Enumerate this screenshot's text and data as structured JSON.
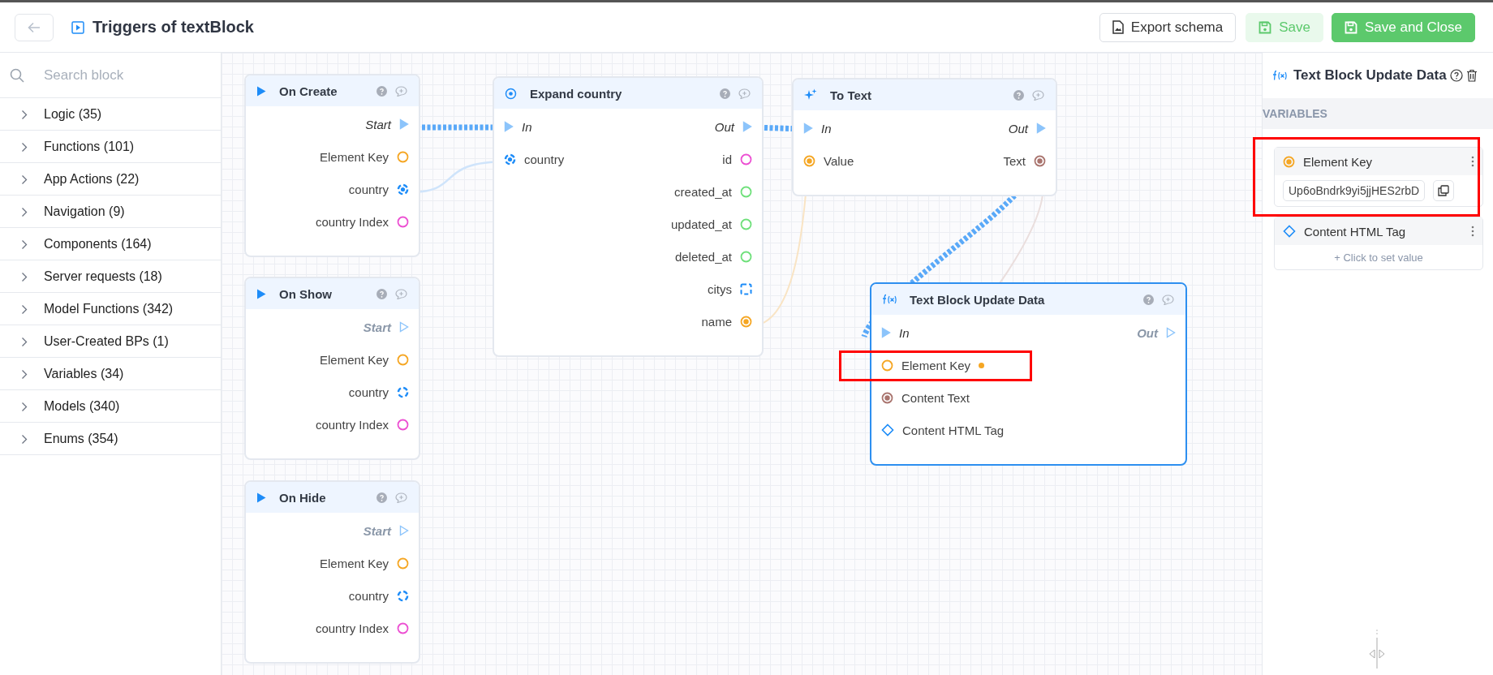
{
  "header": {
    "title": "Triggers of textBlock",
    "buttons": [
      {
        "label": "Export schema",
        "kind": "outline"
      },
      {
        "label": "Save",
        "kind": "light"
      },
      {
        "label": "Save and Close",
        "kind": "primary"
      }
    ]
  },
  "sidebar": {
    "search": {
      "placeholder": "Search block"
    },
    "items": [
      {
        "label": "Logic (35)"
      },
      {
        "label": "Functions (101)"
      },
      {
        "label": "App Actions (22)"
      },
      {
        "label": "Navigation (9)"
      },
      {
        "label": "Components (164)"
      },
      {
        "label": "Server requests (18)"
      },
      {
        "label": "Model Functions (342)"
      },
      {
        "label": "User-Created BPs (1)"
      },
      {
        "label": "Variables (34)"
      },
      {
        "label": "Models (340)"
      },
      {
        "label": "Enums (354)"
      }
    ]
  },
  "nodes": [
    {
      "title": "On Create",
      "kind": "play",
      "selected": false,
      "rows": [
        {
          "right": {
            "label": "Start",
            "kind": "exec",
            "connected": true
          }
        },
        {
          "right": {
            "label": "Element Key",
            "kind": "ring",
            "color": "#f5a623"
          }
        },
        {
          "right": {
            "label": "country",
            "kind": "struct-linked",
            "color": "#1d8cf8"
          }
        },
        {
          "right": {
            "label": "country Index",
            "kind": "ring",
            "color": "#ec4fd2"
          }
        }
      ]
    },
    {
      "title": "On Show",
      "kind": "play",
      "selected": false,
      "rows": [
        {
          "right": {
            "label": "Start",
            "kind": "exec",
            "connected": false
          }
        },
        {
          "right": {
            "label": "Element Key",
            "kind": "ring",
            "color": "#f5a623"
          }
        },
        {
          "right": {
            "label": "country",
            "kind": "struct",
            "color": "#1d8cf8"
          }
        },
        {
          "right": {
            "label": "country Index",
            "kind": "ring",
            "color": "#ec4fd2"
          }
        }
      ]
    },
    {
      "title": "On Hide",
      "kind": "play",
      "selected": false,
      "rows": [
        {
          "right": {
            "label": "Start",
            "kind": "exec",
            "connected": false
          }
        },
        {
          "right": {
            "label": "Element Key",
            "kind": "ring",
            "color": "#f5a623"
          }
        },
        {
          "right": {
            "label": "country",
            "kind": "struct",
            "color": "#1d8cf8"
          }
        },
        {
          "right": {
            "label": "country Index",
            "kind": "ring",
            "color": "#ec4fd2"
          }
        }
      ]
    },
    {
      "title": "Expand country",
      "kind": "target",
      "selected": false,
      "rows": [
        {
          "left": {
            "label": "In",
            "kind": "exec",
            "connected": true
          },
          "right": {
            "label": "Out",
            "kind": "exec",
            "connected": true
          }
        },
        {
          "left": {
            "label": "country",
            "kind": "struct-linked",
            "color": "#1d8cf8"
          },
          "right": {
            "label": "id",
            "kind": "ring",
            "color": "#ec4fd2"
          }
        },
        {
          "right": {
            "label": "created_at",
            "kind": "ring",
            "color": "#6ee07a"
          }
        },
        {
          "right": {
            "label": "updated_at",
            "kind": "ring",
            "color": "#6ee07a"
          }
        },
        {
          "right": {
            "label": "deleted_at",
            "kind": "ring",
            "color": "#6ee07a"
          }
        },
        {
          "right": {
            "label": "citys",
            "kind": "list",
            "color": "#1d8cf8"
          }
        },
        {
          "right": {
            "label": "name",
            "kind": "dot-ring",
            "color": "#f5a623"
          }
        }
      ]
    },
    {
      "title": "To Text",
      "kind": "sparkle",
      "selected": false,
      "rows": [
        {
          "left": {
            "label": "In",
            "kind": "exec",
            "connected": true
          },
          "right": {
            "label": "Out",
            "kind": "exec",
            "connected": true
          }
        },
        {
          "left": {
            "label": "Value",
            "kind": "dot-ring",
            "color": "#f5a623"
          },
          "right": {
            "label": "Text",
            "kind": "dot-ring",
            "color": "#a9746e"
          }
        }
      ]
    },
    {
      "title": "Text Block Update Data",
      "kind": "function",
      "selected": true,
      "rows": [
        {
          "left": {
            "label": "In",
            "kind": "exec",
            "connected": true
          },
          "right": {
            "label": "Out",
            "kind": "exec",
            "connected": false
          }
        },
        {
          "left": {
            "label": "Element Key",
            "kind": "ring",
            "color": "#f5a623",
            "has_value": true,
            "highlighted": true
          }
        },
        {
          "left": {
            "label": "Content Text",
            "kind": "dot-ring",
            "color": "#a9746e"
          }
        },
        {
          "left": {
            "label": "Content HTML Tag",
            "kind": "diamond",
            "color": "#1d8cf8"
          }
        }
      ]
    }
  ],
  "panel": {
    "title": "Text Block Update Data",
    "section": "VARIABLES",
    "variables": [
      {
        "label": "Element Key",
        "kind": "dot-ring",
        "color": "#f5a623",
        "value": "Up6oBndrk9yi5jjHES2rbD",
        "highlighted": true
      },
      {
        "label": "Content HTML Tag",
        "kind": "diamond",
        "color": "#1d8cf8",
        "action": "+ Click to set value",
        "highlighted": false
      }
    ]
  }
}
